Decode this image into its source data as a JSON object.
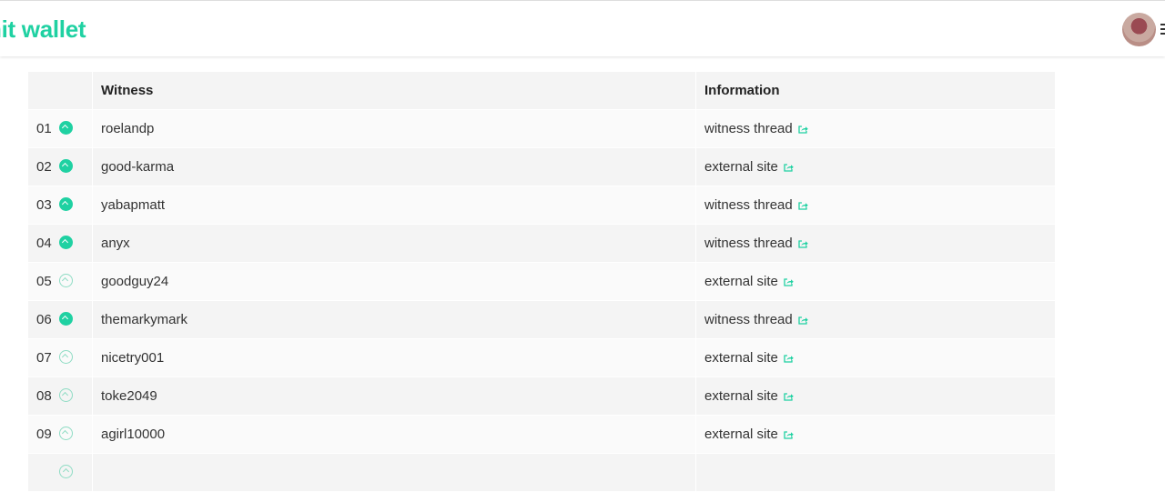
{
  "app": {
    "logo": "hit wallet"
  },
  "colors": {
    "accent": "#1fd1a2"
  },
  "table": {
    "headers": [
      "",
      "Witness",
      "Information"
    ],
    "rows": [
      {
        "rank": "01",
        "voted": true,
        "witness": "roelandp",
        "info": "witness thread"
      },
      {
        "rank": "02",
        "voted": true,
        "witness": "good-karma",
        "info": "external site"
      },
      {
        "rank": "03",
        "voted": true,
        "witness": "yabapmatt",
        "info": "witness thread"
      },
      {
        "rank": "04",
        "voted": true,
        "witness": "anyx",
        "info": "witness thread"
      },
      {
        "rank": "05",
        "voted": false,
        "witness": "goodguy24",
        "info": "external site"
      },
      {
        "rank": "06",
        "voted": true,
        "witness": "themarkymark",
        "info": "witness thread"
      },
      {
        "rank": "07",
        "voted": false,
        "witness": "nicetry001",
        "info": "external site"
      },
      {
        "rank": "08",
        "voted": false,
        "witness": "toke2049",
        "info": "external site"
      },
      {
        "rank": "09",
        "voted": false,
        "witness": "agirl10000",
        "info": "external site"
      }
    ]
  }
}
